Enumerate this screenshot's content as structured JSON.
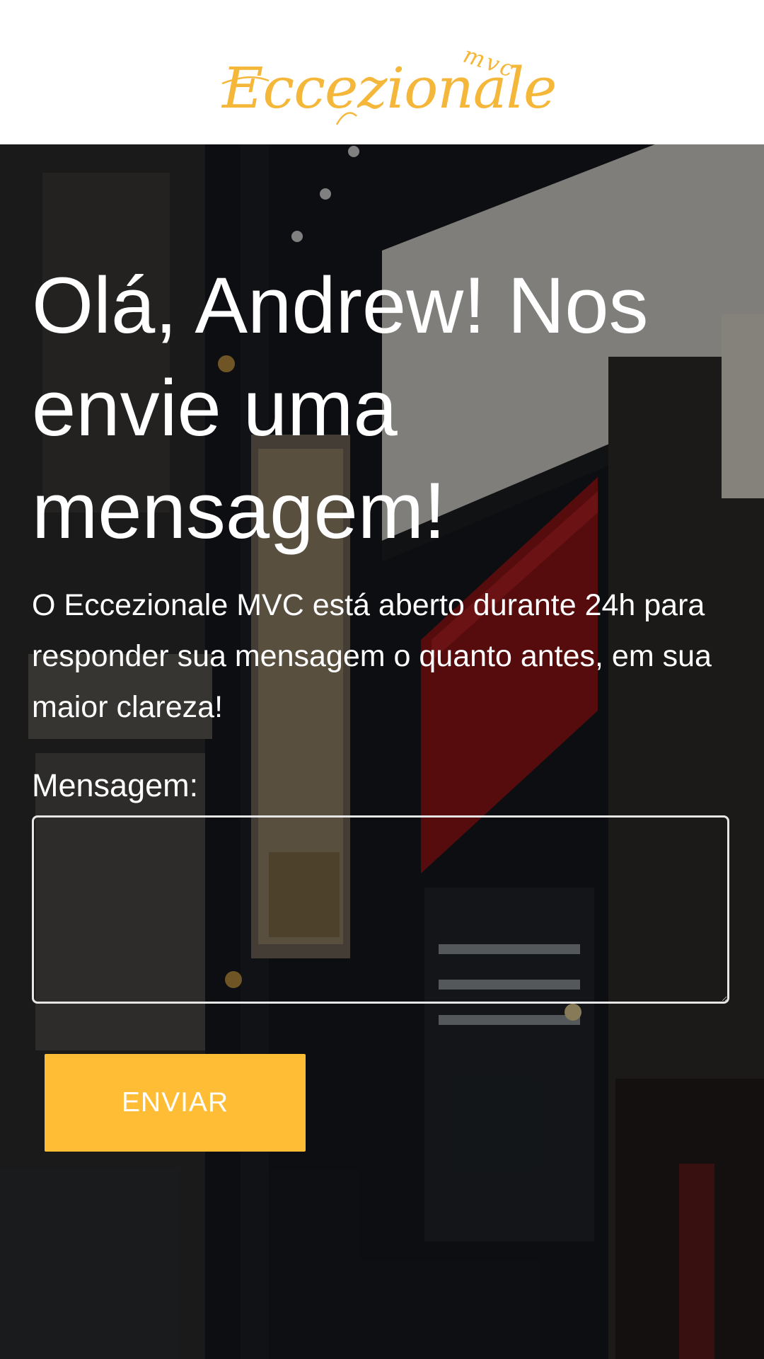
{
  "header": {
    "logo_text": "Eccezionale",
    "logo_suffix": "mvc"
  },
  "hero": {
    "background_image": "storefront-photo",
    "headline": "Olá, Andrew! Nos envie uma mensagem!",
    "lead": "O Eccezionale MVC está aberto durante 24h para responder sua mensagem o quanto antes, em sua maior clareza!"
  },
  "form": {
    "message_label": "Mensagem:",
    "message_value": "",
    "submit_label": "ENVIAR"
  },
  "colors": {
    "accent": "#ffbd35",
    "logo": "#f5b73a",
    "header_bg": "#ffffff",
    "text_on_image": "#ffffff"
  }
}
